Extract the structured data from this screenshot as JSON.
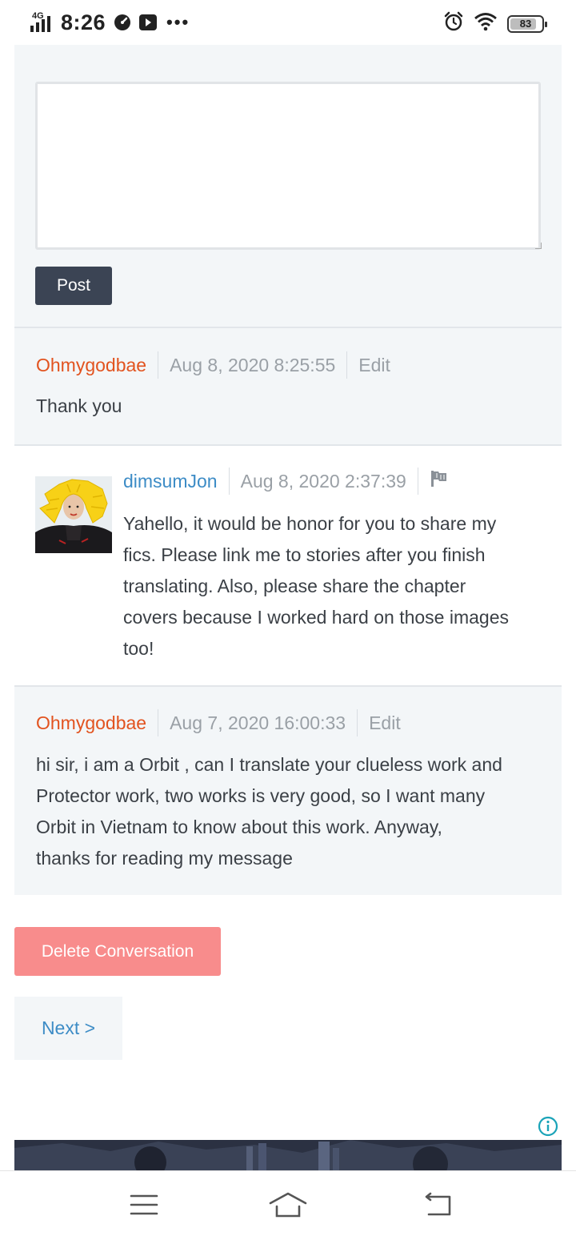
{
  "status_bar": {
    "network": "4G",
    "time": "8:26",
    "battery": "83",
    "battery_level": 0.83,
    "icons": [
      "signal-icon",
      "speedometer-icon",
      "play-icon",
      "more-dots-icon",
      "alarm-icon",
      "wifi-icon",
      "battery-icon"
    ]
  },
  "reply_form": {
    "textarea_value": "",
    "post_label": "Post"
  },
  "messages": [
    {
      "author": "Ohmygodbae",
      "timestamp": "Aug 8, 2020 8:25:55",
      "action": "Edit",
      "body": "Thank you"
    },
    {
      "author": "dimsumJon",
      "timestamp": "Aug 8, 2020 2:37:39",
      "action_icon": "flag-icon",
      "body_lines": [
        "Yahello, it would be honor for you to share my",
        "fics. Please link me to stories after you finish",
        "translating. Also, please share the chapter",
        "covers because I worked hard on those images",
        "too!"
      ]
    },
    {
      "author": "Ohmygodbae",
      "timestamp": "Aug 7, 2020 16:00:33",
      "action": "Edit",
      "body_lines": [
        "hi sir, i am a Orbit , can I translate your clueless work and",
        "Protector work, two works is very good, so I want many",
        "Orbit in Vietnam to know about this work. Anyway,",
        "thanks for reading my message"
      ]
    }
  ],
  "actions": {
    "delete_label": "Delete Conversation",
    "next_label": "Next >"
  },
  "colors": {
    "self_author": "#e2531f",
    "other_author": "#3d8cc6",
    "post_button": "#3b4454",
    "delete_button": "#f88c8c",
    "panel_bg": "#f3f6f8"
  },
  "nav_bar": {
    "icons": [
      "menu-icon",
      "home-icon",
      "back-icon"
    ]
  }
}
